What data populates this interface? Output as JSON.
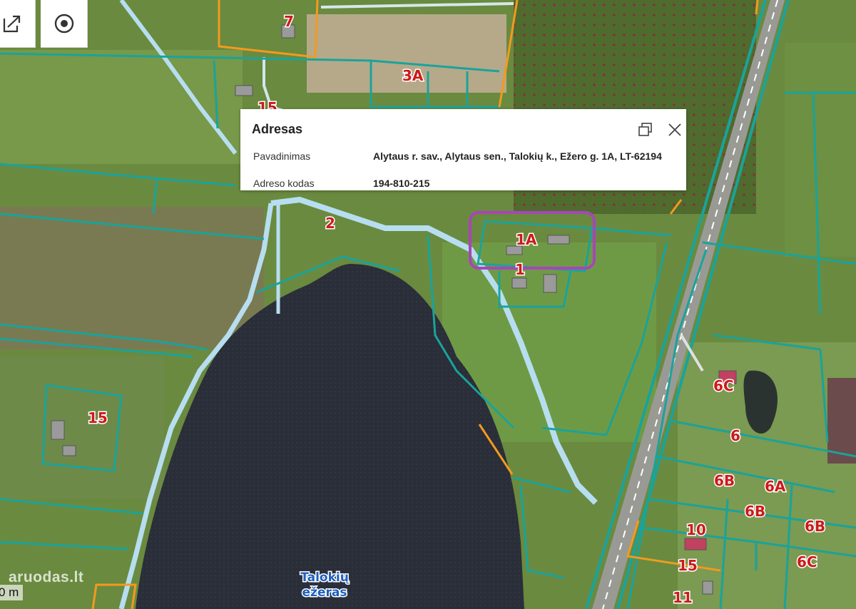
{
  "map": {
    "parcel_labels": [
      "7",
      "3A",
      "15",
      "2",
      "1A",
      "1",
      "15",
      "6C",
      "6",
      "6B",
      "6A",
      "6B",
      "10",
      "6B",
      "6C",
      "15",
      "11"
    ],
    "lake_label_line1": "Talokių",
    "lake_label_line2": "ežeras",
    "colors": {
      "parcel_border": "#1aa39a",
      "road_border": "#a9d6e6",
      "highlight": "#a845b8",
      "orange_border": "#f39a1e",
      "label": "#cc1a1a"
    }
  },
  "toolbar": {
    "share_icon": "share-icon",
    "locate_icon": "locate-icon"
  },
  "popup": {
    "title": "Adresas",
    "name_label": "Pavadinimas",
    "name_value": "Alytaus r. sav., Alytaus sen., Talokių k., Ežero g. 1A, LT-62194",
    "code_label": "Adreso kodas",
    "code_value": "194-810-215"
  },
  "scale_text": "0 m",
  "watermark": "aruodas.lt"
}
